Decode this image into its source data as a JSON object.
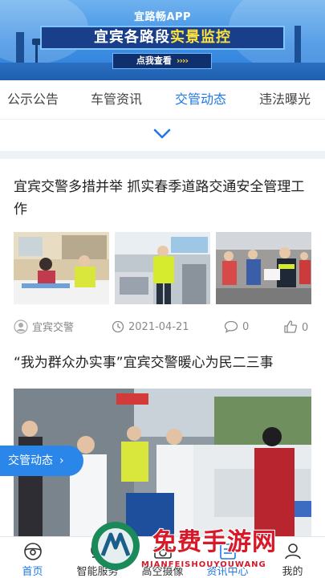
{
  "banner": {
    "subtitle": "宜路畅APP",
    "title_pre": "宜宾各路段",
    "title_highlight": "实景监控",
    "button_label": "点我查看",
    "button_arrows": "››››"
  },
  "tabs": [
    {
      "label": "公示公告"
    },
    {
      "label": "车管资讯"
    },
    {
      "label": "交管动态"
    },
    {
      "label": "违法曝光"
    }
  ],
  "active_tab": "交管动态",
  "articles": [
    {
      "title": "宜宾交警多措并举 抓实春季道路交通安全管理工作",
      "author": "宜宾交警",
      "date": "2021-04-21",
      "comments": "0",
      "likes": "0"
    },
    {
      "title": "“我为群众办实事”宜宾交警暖心为民二三事"
    }
  ],
  "float_button": {
    "label": "交管动态",
    "arrow": "›"
  },
  "bottom_nav": [
    {
      "label": "首页",
      "icon": "steering-wheel-icon"
    },
    {
      "label": "智能服务",
      "icon": "service-icon"
    },
    {
      "label": "高空摄像",
      "icon": "camera-icon"
    },
    {
      "label": "资讯中心",
      "icon": "news-icon"
    },
    {
      "label": "我的",
      "icon": "user-icon"
    }
  ],
  "watermark": {
    "text": "免费手游网",
    "sub": "MIANFEISHOUYOUWANG"
  },
  "colors": {
    "accent": "#1f78e6",
    "banner": "#3d8fe3",
    "highlight": "#ffe23a",
    "watermark": "#d7192a"
  }
}
